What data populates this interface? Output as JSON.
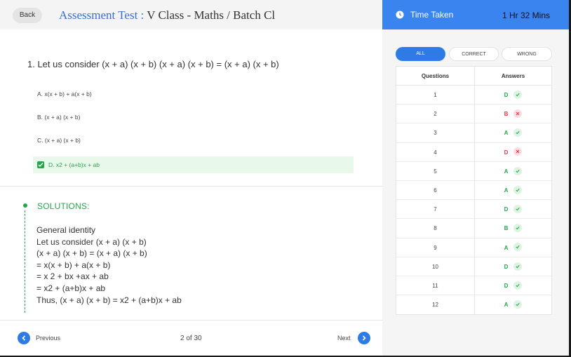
{
  "header": {
    "back_label": "Back",
    "title_prefix": "Assessment Test : ",
    "title_rest": "V Class - Maths / Batch Cl"
  },
  "question": {
    "text": "1. Let us consider (x + a) (x + b) (x + a) (x + b) = (x + a) (x + b)",
    "options": [
      {
        "label": "A. x(x + b) + a(x + b)",
        "selected": false
      },
      {
        "label": "B. (x + a) (x + b)",
        "selected": false
      },
      {
        "label": "C. (x + a) (x + b)",
        "selected": false
      },
      {
        "label": "D. x2 + (a+b)x + ab",
        "selected": true
      }
    ]
  },
  "solution": {
    "title": "SOLUTIONS:",
    "lines": [
      "General identity",
      "Let us consider (x + a) (x + b)",
      "(x + a) (x + b) = (x + a) (x + b)",
      "= x(x + b) + a(x + b)",
      "= x 2 + bx +ax + ab",
      "= x2 + (a+b)x + ab",
      "Thus, (x + a) (x + b) = x2 + (a+b)x + ab"
    ]
  },
  "footer": {
    "previous_label": "Previous",
    "page_counter": "2 of 30",
    "next_label": "Next"
  },
  "timer": {
    "label": "Time Taken",
    "value": "1 Hr 32 Mins"
  },
  "filters": {
    "all": "ALL",
    "correct": "CORRECT",
    "wrong": "WRONG",
    "active": "all"
  },
  "answers_table": {
    "header_questions": "Questions",
    "header_answers": "Answers",
    "rows": [
      {
        "q": "1",
        "a": "D",
        "status": "correct"
      },
      {
        "q": "2",
        "a": "B",
        "status": "wrong"
      },
      {
        "q": "3",
        "a": "A",
        "status": "correct"
      },
      {
        "q": "4",
        "a": "D",
        "status": "wrong"
      },
      {
        "q": "5",
        "a": "A",
        "status": "correct"
      },
      {
        "q": "6",
        "a": "A",
        "status": "correct"
      },
      {
        "q": "7",
        "a": "D",
        "status": "correct"
      },
      {
        "q": "8",
        "a": "B",
        "status": "correct"
      },
      {
        "q": "9",
        "a": "A",
        "status": "correct"
      },
      {
        "q": "10",
        "a": "D",
        "status": "correct"
      },
      {
        "q": "11",
        "a": "D",
        "status": "correct"
      },
      {
        "q": "12",
        "a": "A",
        "status": "correct"
      }
    ]
  },
  "colors": {
    "accent_blue": "#2f7be5",
    "correct_green": "#22a84b",
    "wrong_red": "#e5364a"
  }
}
